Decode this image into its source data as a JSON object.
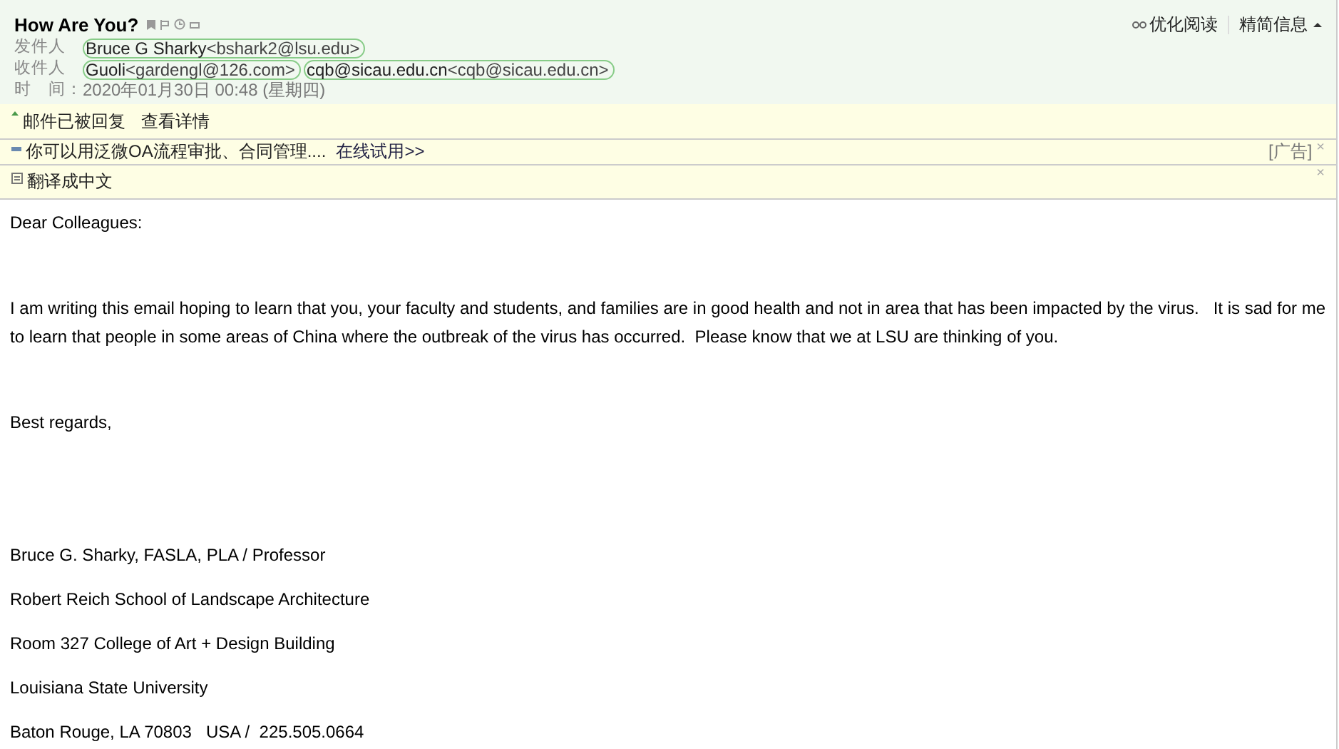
{
  "subject": "How Are You?",
  "header_links": [
    {
      "label": "优化阅读"
    },
    {
      "label": "精简信息"
    }
  ],
  "fields": [
    {
      "label": "发件人",
      "contacts": [
        {
          "name": "Bruce G Sharky",
          "address": "<bshark2@lsu.edu>"
        }
      ]
    },
    {
      "label": "收件人",
      "contacts": [
        {
          "name": "Guoli",
          "address": "<gardengl@126.com>"
        },
        {
          "name": "cqb@sicau.edu.cn",
          "address": "<cqb@sicau.edu.cn>"
        }
      ]
    },
    {
      "label": "时　间：",
      "value": "2020年01月30日 00:48 (星期四)"
    }
  ],
  "notices": [
    {
      "kind": "reply",
      "text": "邮件已被回复",
      "link": "查看详情"
    },
    {
      "kind": "ad",
      "text": "你可以用泛微OA流程审批、合同管理....",
      "link": "在线试用>>",
      "tag": "[广告]",
      "close": "×"
    },
    {
      "kind": "translate",
      "text": "翻译成中文",
      "close": "×"
    }
  ],
  "body": [
    "Dear Colleagues:",
    "I am writing this email hoping to learn that you, your faculty and students, and families are in good health and not in area that has been impacted by the virus.   It is sad for me to learn that people in some areas of China where the outbreak of the virus has occurred.  Please know that we at LSU are thinking of you.",
    "Best regards,",
    "Bruce G. Sharky, FASLA, PLA / Professor",
    "Robert Reich School of Landscape Architecture",
    "Room 327 College of Art + Design Building",
    "Louisiana State University",
    "Baton Rouge, LA 70803   USA /  225.505.0664"
  ]
}
